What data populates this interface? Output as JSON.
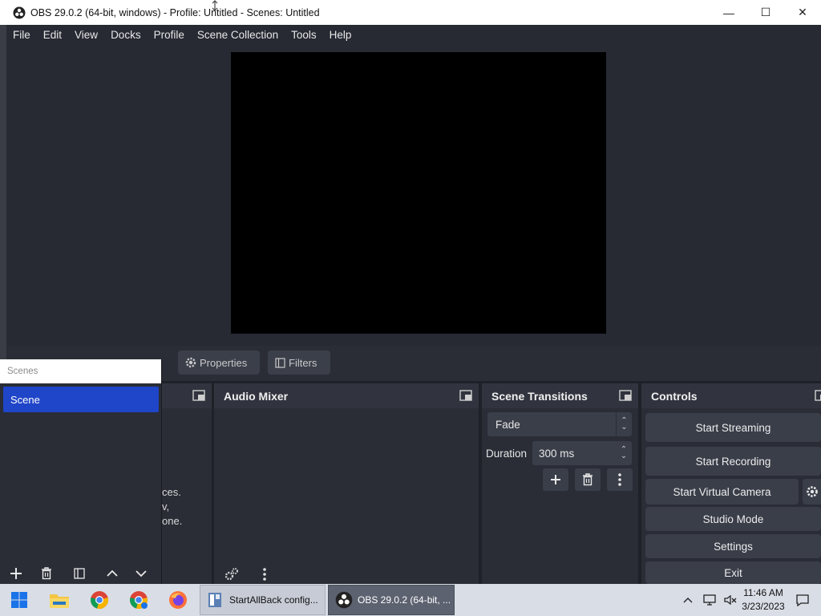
{
  "window": {
    "title": "OBS 29.0.2 (64-bit, windows) - Profile: Untitled - Scenes: Untitled",
    "minimize": "—",
    "maximize": "☐",
    "close": "✕"
  },
  "menu": [
    "File",
    "Edit",
    "View",
    "Docks",
    "Profile",
    "Scene Collection",
    "Tools",
    "Help"
  ],
  "source_toolbar": {
    "properties": "Properties",
    "filters": "Filters"
  },
  "scenes": {
    "title": "Scenes",
    "items": [
      "Scene"
    ]
  },
  "sources": {
    "hint_lines": [
      "ces.",
      "v,",
      "one."
    ]
  },
  "audio_mixer": {
    "title": "Audio Mixer"
  },
  "transitions": {
    "title": "Scene Transitions",
    "selected": "Fade",
    "duration_label": "Duration",
    "duration_value": "300 ms"
  },
  "controls": {
    "title": "Controls",
    "start_streaming": "Start Streaming",
    "start_recording": "Start Recording",
    "start_virtual_camera": "Start Virtual Camera",
    "studio_mode": "Studio Mode",
    "settings": "Settings",
    "exit": "Exit"
  },
  "taskbar": {
    "tasks": [
      "StartAllBack config...",
      "OBS 29.0.2 (64-bit, ..."
    ],
    "time": "11:46 AM",
    "date": "3/23/2023"
  },
  "colors": {
    "accent": "#1f45c8",
    "panel": "#2a2d36",
    "button": "#3a3e49"
  }
}
